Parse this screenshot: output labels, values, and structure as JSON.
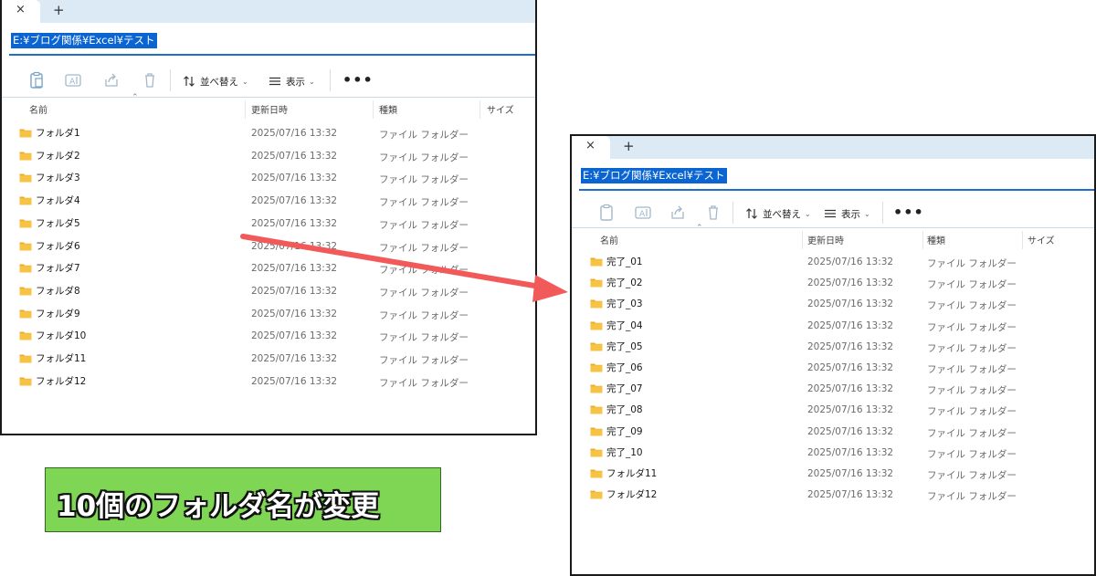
{
  "colors": {
    "accent": "#0a64d2",
    "arrow": "#f25a5a",
    "caption_bg": "#7fd655",
    "folder": "#f6c344"
  },
  "caption": "10個のフォルダ名が変更",
  "windows": [
    {
      "tab_close": "×",
      "tab_plus": "+",
      "address": "E:¥ブログ関係¥Excel¥テスト",
      "toolbar": {
        "sort_label": "並べ替え",
        "view_label": "表示",
        "more_label": "•••",
        "caret": "⌄"
      },
      "columns": [
        "名前",
        "更新日時",
        "種類",
        "サイズ"
      ],
      "rows": [
        {
          "name": "フォルダ1",
          "date": "2025/07/16 13:32",
          "type": "ファイル フォルダー"
        },
        {
          "name": "フォルダ2",
          "date": "2025/07/16 13:32",
          "type": "ファイル フォルダー"
        },
        {
          "name": "フォルダ3",
          "date": "2025/07/16 13:32",
          "type": "ファイル フォルダー"
        },
        {
          "name": "フォルダ4",
          "date": "2025/07/16 13:32",
          "type": "ファイル フォルダー"
        },
        {
          "name": "フォルダ5",
          "date": "2025/07/16 13:32",
          "type": "ファイル フォルダー"
        },
        {
          "name": "フォルダ6",
          "date": "2025/07/16 13:32",
          "type": "ファイル フォルダー"
        },
        {
          "name": "フォルダ7",
          "date": "2025/07/16 13:32",
          "type": "ファイル フォルダー"
        },
        {
          "name": "フォルダ8",
          "date": "2025/07/16 13:32",
          "type": "ファイル フォルダー"
        },
        {
          "name": "フォルダ9",
          "date": "2025/07/16 13:32",
          "type": "ファイル フォルダー"
        },
        {
          "name": "フォルダ10",
          "date": "2025/07/16 13:32",
          "type": "ファイル フォルダー"
        },
        {
          "name": "フォルダ11",
          "date": "2025/07/16 13:32",
          "type": "ファイル フォルダー"
        },
        {
          "name": "フォルダ12",
          "date": "2025/07/16 13:32",
          "type": "ファイル フォルダー"
        }
      ]
    },
    {
      "tab_close": "×",
      "tab_plus": "+",
      "address": "E:¥ブログ関係¥Excel¥テスト",
      "toolbar": {
        "sort_label": "並べ替え",
        "view_label": "表示",
        "more_label": "•••",
        "caret": "⌄"
      },
      "columns": [
        "名前",
        "更新日時",
        "種類",
        "サイズ"
      ],
      "rows": [
        {
          "name": "完了_01",
          "date": "2025/07/16 13:32",
          "type": "ファイル フォルダー"
        },
        {
          "name": "完了_02",
          "date": "2025/07/16 13:32",
          "type": "ファイル フォルダー"
        },
        {
          "name": "完了_03",
          "date": "2025/07/16 13:32",
          "type": "ファイル フォルダー"
        },
        {
          "name": "完了_04",
          "date": "2025/07/16 13:32",
          "type": "ファイル フォルダー"
        },
        {
          "name": "完了_05",
          "date": "2025/07/16 13:32",
          "type": "ファイル フォルダー"
        },
        {
          "name": "完了_06",
          "date": "2025/07/16 13:32",
          "type": "ファイル フォルダー"
        },
        {
          "name": "完了_07",
          "date": "2025/07/16 13:32",
          "type": "ファイル フォルダー"
        },
        {
          "name": "完了_08",
          "date": "2025/07/16 13:32",
          "type": "ファイル フォルダー"
        },
        {
          "name": "完了_09",
          "date": "2025/07/16 13:32",
          "type": "ファイル フォルダー"
        },
        {
          "name": "完了_10",
          "date": "2025/07/16 13:32",
          "type": "ファイル フォルダー"
        },
        {
          "name": "フォルダ11",
          "date": "2025/07/16 13:32",
          "type": "ファイル フォルダー"
        },
        {
          "name": "フォルダ12",
          "date": "2025/07/16 13:32",
          "type": "ファイル フォルダー"
        }
      ]
    }
  ]
}
